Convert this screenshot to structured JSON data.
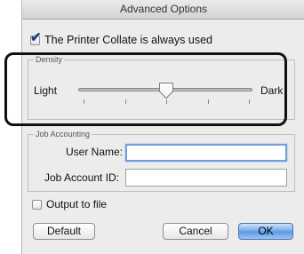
{
  "window": {
    "title": "Advanced Options"
  },
  "collate": {
    "label": "The Printer Collate is always used",
    "checked": true
  },
  "density": {
    "group_title": "Density",
    "min_label": "Light",
    "max_label": "Dark",
    "tick_count": 5,
    "value_fraction": 0.5
  },
  "job_accounting": {
    "group_title": "Job Accounting",
    "user_name_label": "User Name:",
    "user_name_value": "",
    "job_account_id_label": "Job Account ID:",
    "job_account_id_value": ""
  },
  "output_to_file": {
    "label": "Output to file",
    "checked": false
  },
  "buttons": {
    "default_label": "Default",
    "cancel_label": "Cancel",
    "ok_label": "OK"
  },
  "colors": {
    "highlight_outline": "#111111",
    "focus_ring": "#6f9ed8",
    "default_button": "#5b97e4",
    "checkmark": "#1c3c86"
  }
}
